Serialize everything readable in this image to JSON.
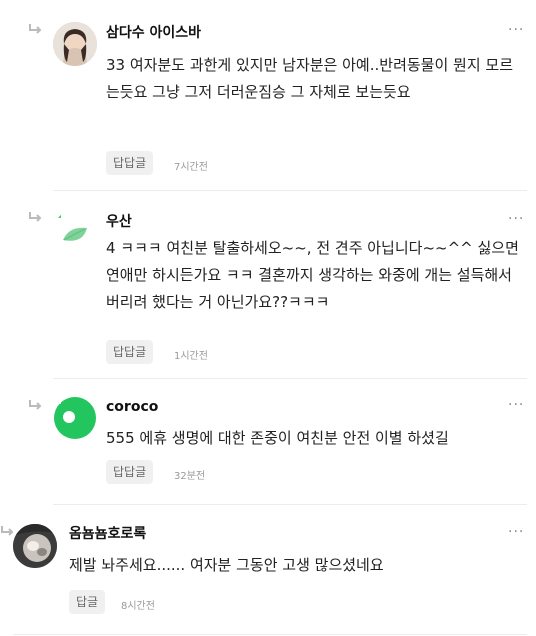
{
  "comments": [
    {
      "username": "삼다수 아이스바",
      "avatar": "photo-portrait",
      "body": "33 여자분도 과한게 있지만 남자분은 아예..반려동물이 뭔지 모르는듯요 그냥 그저 더러운짐승 그 자체로 보는듯요",
      "reply_label": "답답글",
      "time": "7시간전",
      "more_label": "···"
    },
    {
      "username": "우산",
      "avatar": "leaf-icon",
      "body": "4 ㅋㅋㅋ 여친분 탈출하세오~~, 전 견주 아닙니다~~^^ 싫으면 연애만 하시든가요 ㅋㅋ 결혼까지 생각하는 와중에 개는 설득해서 버리려 했다는 거 아닌가요??ㅋㅋㅋ",
      "reply_label": "답답글",
      "time": "1시간전",
      "more_label": "···"
    },
    {
      "username": "coroco",
      "avatar": "green-circle-icon",
      "body": "555 에휴 생명에 대한 존중이 여친분 안전 이별 하셨길",
      "reply_label": "답답글",
      "time": "32분전",
      "more_label": "···"
    },
    {
      "username": "옴뇸뇸호로록",
      "avatar": "photo-cat",
      "body": "제발 놔주세요...... 여자분 그동안 고생 많으셨네요",
      "reply_label": "답글",
      "time": "8시간전",
      "more_label": "···"
    }
  ],
  "colors": {
    "accent_green": "#22c55e",
    "leaf_green": "#7fd39a",
    "reply_bg": "#f0f0f0",
    "divider": "#ececec"
  }
}
